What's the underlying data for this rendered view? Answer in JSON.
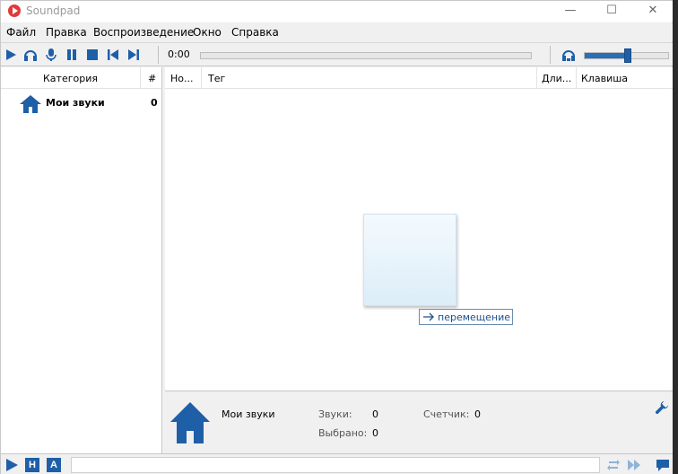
{
  "window": {
    "title": "Soundpad",
    "minimize": "—",
    "maximize": "☐",
    "close": "✕"
  },
  "menu": [
    "Файл",
    "Правка",
    "Воспроизведение",
    "Окно",
    "Справка"
  ],
  "toolbar": {
    "time": "0:00"
  },
  "volume": {
    "level": 0.52
  },
  "categories": {
    "header_name": "Категория",
    "header_count": "#",
    "items": [
      {
        "name": "Мои звуки",
        "count": "0",
        "icon": "home-icon"
      }
    ]
  },
  "table": {
    "columns": [
      "Но...",
      "Тег",
      "Дли...",
      "Клавиша"
    ]
  },
  "drag": {
    "label": "перемещение"
  },
  "info": {
    "category": "Мои звуки",
    "sounds_label": "Звуки:",
    "sounds_value": "0",
    "counter_label": "Счетчик:",
    "counter_value": "0",
    "selected_label": "Выбрано:",
    "selected_value": "0"
  },
  "status": {
    "key_h": "H",
    "key_a": "A"
  },
  "colors": {
    "accent": "#1e5fa8",
    "title_icon": "#e03a3a"
  }
}
